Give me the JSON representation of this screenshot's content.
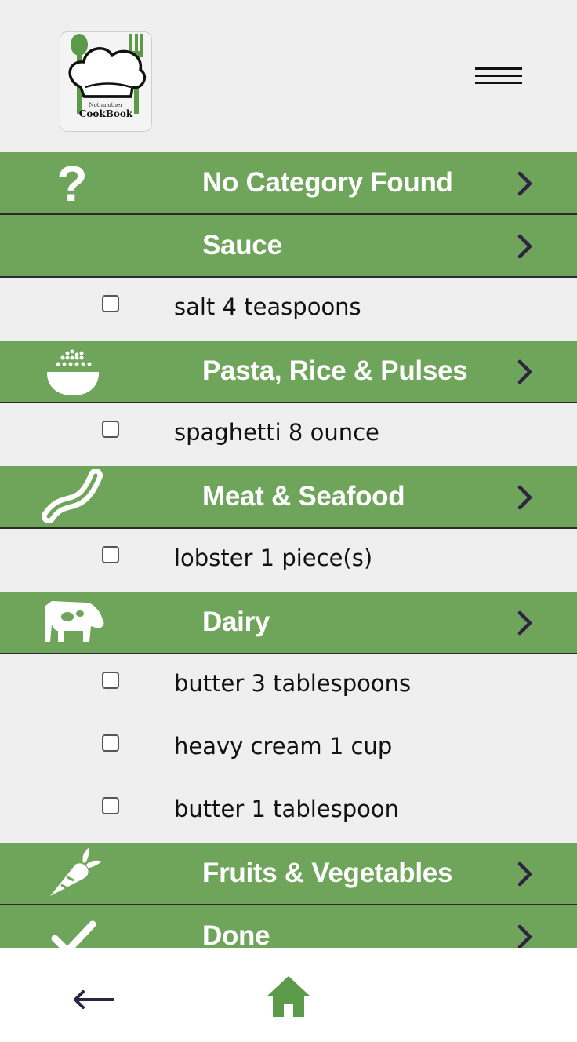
{
  "header": {
    "logo_small_text": "Not another",
    "logo_big_text": "CookBook",
    "menu_icon": "hamburger-menu-icon"
  },
  "colors": {
    "category_bg": "#6fa55b",
    "page_bg": "#efefef",
    "chevron": "#2e2340",
    "accent_green": "#5a9a48"
  },
  "groups": [
    {
      "name": "no-category",
      "label": "No Category Found",
      "icon": "question-mark-icon",
      "items": []
    },
    {
      "name": "sauce",
      "label": "Sauce",
      "icon": "",
      "items": [
        {
          "text": "salt 4 teaspoons",
          "checked": false
        }
      ]
    },
    {
      "name": "pasta-rice-pulses",
      "label": "Pasta, Rice & Pulses",
      "icon": "rice-bowl-icon",
      "items": [
        {
          "text": "spaghetti 8 ounce",
          "checked": false
        }
      ]
    },
    {
      "name": "meat-seafood",
      "label": "Meat & Seafood",
      "icon": "bacon-icon",
      "items": [
        {
          "text": "lobster 1 piece(s)",
          "checked": false
        }
      ]
    },
    {
      "name": "dairy",
      "label": "Dairy",
      "icon": "cow-icon",
      "items": [
        {
          "text": "butter 3 tablespoons",
          "checked": false
        },
        {
          "text": "heavy cream 1 cup",
          "checked": false
        },
        {
          "text": "butter 1 tablespoon",
          "checked": false
        }
      ]
    },
    {
      "name": "fruits-vegetables",
      "label": "Fruits & Vegetables",
      "icon": "carrot-icon",
      "items": []
    },
    {
      "name": "done",
      "label": "Done",
      "icon": "checkmark-icon",
      "items": []
    }
  ],
  "bottom_nav": {
    "back_icon": "back-arrow-icon",
    "home_icon": "home-icon"
  }
}
